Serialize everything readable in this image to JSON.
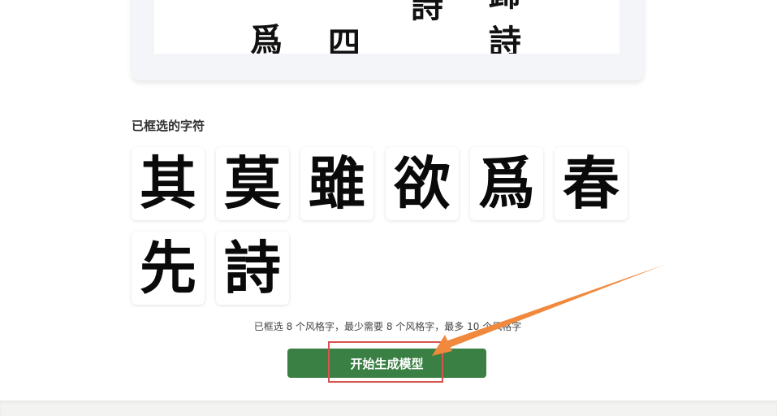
{
  "preview": {
    "glyphs": [
      "爲",
      "四",
      "詩",
      "歸",
      "詩"
    ]
  },
  "selected_section": {
    "title": "已框选的字符",
    "characters": [
      "其",
      "莫",
      "雖",
      "欲",
      "爲",
      "春",
      "先",
      "詩"
    ]
  },
  "status": {
    "text": "已框选 8 个风格字，最少需要 8 个风格字，最多 10 个风格字"
  },
  "actions": {
    "generate_label": "开始生成模型",
    "button_color": "#3a7f43",
    "highlight_color": "#d9534f",
    "arrow_color": "#f0893d"
  }
}
